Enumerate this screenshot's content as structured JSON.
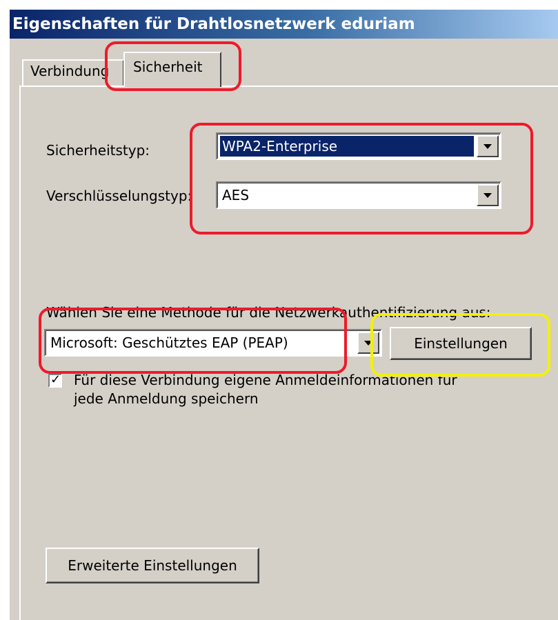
{
  "window": {
    "title": "Eigenschaften für Drahtlosnetzwerk eduriam"
  },
  "tabs": [
    {
      "label": "Verbindung",
      "active": false
    },
    {
      "label": "Sicherheit",
      "active": true
    }
  ],
  "security": {
    "type_label": "Sicherheitstyp:",
    "type_value": "WPA2-Enterprise",
    "encryption_label": "Verschlüsselungstyp:",
    "encryption_value": "AES"
  },
  "auth": {
    "method_label": "Wählen Sie eine Methode für die Netzwerkauthentifizierung aus:",
    "method_value": "Microsoft: Geschütztes EAP (PEAP)",
    "settings_button": "Einstellungen",
    "remember_checked": true,
    "remember_line1": "Für diese Verbindung eigene Anmeldeinformationen für",
    "remember_line2": "jede Anmeldung speichern"
  },
  "advanced_button": "Erweiterte Einstellungen",
  "colors": {
    "dialog_bg": "#d4d0c8",
    "title_gradient_start": "#0a246a",
    "selection_bg": "#0a246a",
    "highlight_red": "#ee1a2a",
    "highlight_yellow": "#f3f00a"
  },
  "icons": {
    "dropdown": "chevron-down-icon",
    "checkbox": "check-icon"
  }
}
